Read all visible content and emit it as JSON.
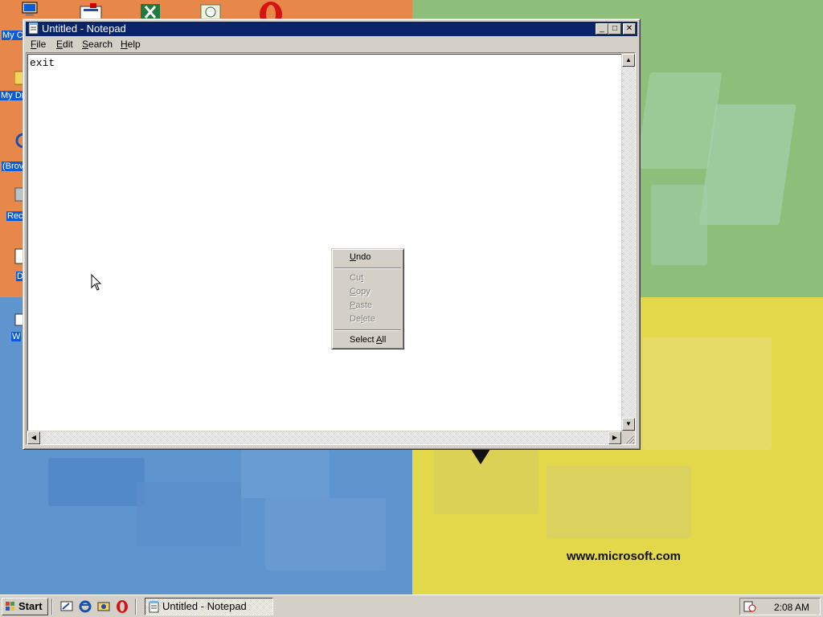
{
  "desktop": {
    "watermark_url": "www.microsoft.com",
    "icons": [
      {
        "name": "my-computer",
        "label": "My C"
      },
      {
        "name": "my-documents",
        "label": "My Dr"
      },
      {
        "name": "browser",
        "label": "(Brov"
      },
      {
        "name": "recycle-bin",
        "label": "Rec"
      },
      {
        "name": "d-item",
        "label": "D"
      },
      {
        "name": "w-item",
        "label": "W"
      }
    ]
  },
  "window": {
    "title": "Untitled - Notepad",
    "controls": {
      "minimize": "_",
      "maximize": "□",
      "close": "✕"
    },
    "menu": {
      "file": {
        "accel": "F",
        "rest": "ile"
      },
      "edit": {
        "accel": "E",
        "rest": "dit"
      },
      "search": {
        "accel": "S",
        "rest": "earch"
      },
      "help": {
        "accel": "H",
        "rest": "elp"
      }
    },
    "content": "exit"
  },
  "context_menu": {
    "items": {
      "undo": {
        "accel": "U",
        "rest": "ndo",
        "enabled": true
      },
      "cut": {
        "pre": "Cu",
        "accel": "t",
        "rest": "",
        "enabled": false
      },
      "copy": {
        "accel": "C",
        "rest": "opy",
        "enabled": false
      },
      "paste": {
        "accel": "P",
        "rest": "aste",
        "enabled": false
      },
      "delete": {
        "pre": "De",
        "accel": "l",
        "rest": "ete",
        "enabled": false
      },
      "select_all": {
        "pre": "Select ",
        "accel": "A",
        "rest": "ll",
        "enabled": true
      }
    }
  },
  "taskbar": {
    "start_label": "Start",
    "task_label": "Untitled - Notepad",
    "clock": "2:08 AM"
  }
}
